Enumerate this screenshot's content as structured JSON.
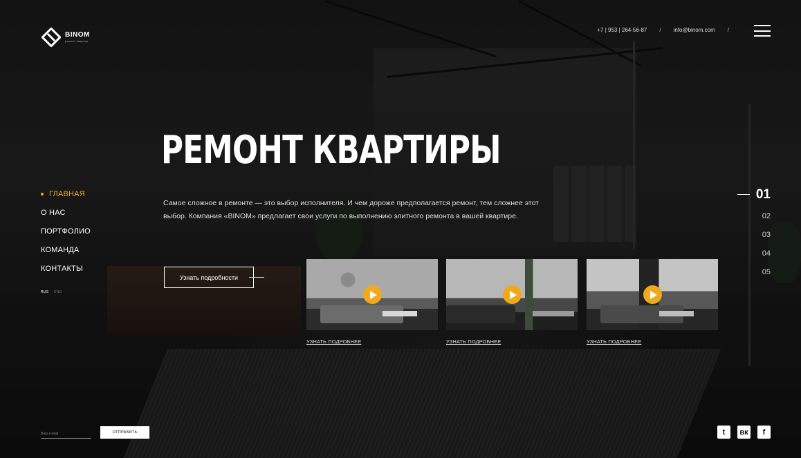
{
  "brand": {
    "name": "BINOM",
    "tagline": "ремонт квартир"
  },
  "header": {
    "phone": "+7 | 953 | 264-56-87",
    "email": "info@binom.com",
    "separator": "/"
  },
  "hero": {
    "title": "РЕМОНТ КВАРТИРЫ",
    "description": "Самое сложное в ремонте — это выбор исполнителя. И чем дороже предполагается ремонт, тем сложнее этот выбор. Компания «BINOM» предлагает свои услуги по выполнению элитного ремонта в вашей квартире.",
    "more_button": "Узнать подробности"
  },
  "nav": {
    "items": [
      "ГЛАВНАЯ",
      "О НАС",
      "ПОРТФОЛИО",
      "КОМАНДА",
      "КОНТАКТЫ"
    ],
    "active_index": 0
  },
  "lang": {
    "active": "RUS",
    "other": "ENG"
  },
  "slides": [
    "01",
    "02",
    "03",
    "04",
    "05"
  ],
  "thumbnails": [
    {
      "link": "УЗНАТЬ ПОДРОБНЕЕ",
      "icon": "play-icon"
    },
    {
      "link": "УЗНАТЬ ПОДРОБНЕЕ",
      "icon": "play-icon"
    },
    {
      "link": "УЗНАТЬ ПОДРОБНЕЕ",
      "icon": "play-icon"
    }
  ],
  "subscribe": {
    "placeholder": "Ваш e-mail",
    "button": "ОТПРАВИТЬ"
  },
  "social": {
    "twitter": "t",
    "vk": "вк",
    "facebook": "f"
  },
  "colors": {
    "accent": "#f0a91f",
    "text": "#ffffff",
    "background": "#151515"
  }
}
